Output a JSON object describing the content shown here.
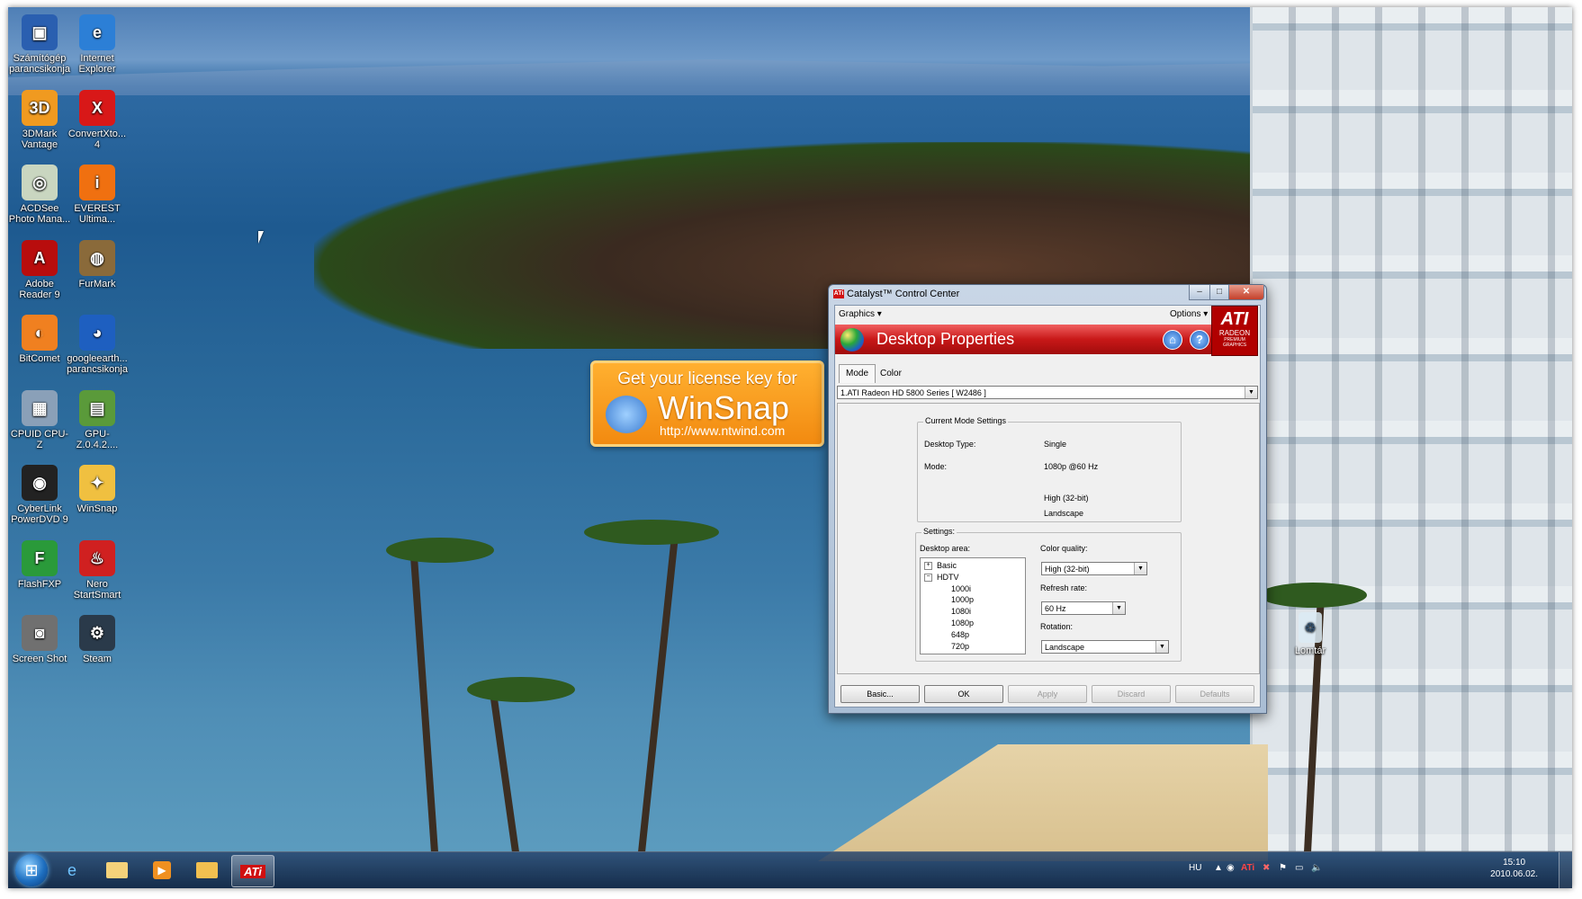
{
  "desktop": {
    "icons": [
      {
        "label": "Számítógép parancsikonja",
        "icon": "computer-icon",
        "color": "#2a5fb0"
      },
      {
        "label": "Internet Explorer",
        "icon": "internet-explorer-icon",
        "color": "#2c7fd6"
      },
      {
        "label": "3DMark Vantage",
        "icon": "3dmark-icon",
        "color": "#f09a20"
      },
      {
        "label": "ConvertXto... 4",
        "icon": "convertx-icon",
        "color": "#d81818"
      },
      {
        "label": "ACDSee Photo Mana...",
        "icon": "acdsee-icon",
        "color": "#c9d6c0"
      },
      {
        "label": "EVEREST Ultima...",
        "icon": "everest-icon",
        "color": "#f07010"
      },
      {
        "label": "Adobe Reader 9",
        "icon": "adobe-reader-icon",
        "color": "#b80d0d"
      },
      {
        "label": "FurMark",
        "icon": "furmark-icon",
        "color": "#8a6a3a"
      },
      {
        "label": "BitComet",
        "icon": "bitcomet-icon",
        "color": "#f08020"
      },
      {
        "label": "googleearth... parancsikonja",
        "icon": "google-earth-icon",
        "color": "#1e5fc0"
      },
      {
        "label": "CPUID CPU-Z",
        "icon": "cpuz-icon",
        "color": "#8aa0b8"
      },
      {
        "label": "GPU-Z.0.4.2....",
        "icon": "gpuz-icon",
        "color": "#5a9a3a"
      },
      {
        "label": "CyberLink PowerDVD 9",
        "icon": "powerdvd-icon",
        "color": "#222222"
      },
      {
        "label": "WinSnap",
        "icon": "winsnap-icon",
        "color": "#f0c040"
      },
      {
        "label": "FlashFXP",
        "icon": "flashfxp-icon",
        "color": "#2a9a3a"
      },
      {
        "label": "Nero StartSmart",
        "icon": "nero-icon",
        "color": "#d02020"
      },
      {
        "label": "Screen Shot",
        "icon": "camera-icon",
        "color": "#707070"
      },
      {
        "label": "Steam",
        "icon": "steam-icon",
        "color": "#2a3a4a"
      }
    ],
    "recycle_bin": {
      "label": "Lomtár",
      "icon": "recycle-bin-icon"
    }
  },
  "promo": {
    "line1": "Get your license key for",
    "line2": "WinSnap",
    "url": "http://www.ntwind.com"
  },
  "window": {
    "title": "Catalyst™ Control Center",
    "menu": {
      "graphics": "Graphics ▾",
      "options": "Options ▾"
    },
    "banner_title": "Desktop Properties",
    "logo": {
      "brand": "ATI",
      "line2": "RADEON",
      "line3": "PREMIUM GRAPHICS"
    },
    "tabs": [
      "Mode",
      "Color"
    ],
    "display_select": "1.ATI Radeon HD 5800 Series [ W2486 ]",
    "current_mode": {
      "legend": "Current Mode Settings",
      "desktop_type_label": "Desktop Type:",
      "desktop_type_value": "Single",
      "mode_label": "Mode:",
      "mode_value": "1080p @60 Hz",
      "color_value": "High (32-bit)",
      "rotation_value": "Landscape"
    },
    "settings": {
      "legend": "Settings:",
      "desktop_area_label": "Desktop area:",
      "tree": [
        {
          "label": "Basic",
          "toggle": "+",
          "level": 0
        },
        {
          "label": "HDTV",
          "toggle": "−",
          "level": 0
        },
        {
          "label": "1000i",
          "toggle": "",
          "level": 1
        },
        {
          "label": "1000p",
          "toggle": "",
          "level": 1
        },
        {
          "label": "1080i",
          "toggle": "",
          "level": 1
        },
        {
          "label": "1080p",
          "toggle": "",
          "level": 1
        },
        {
          "label": "648p",
          "toggle": "",
          "level": 1
        },
        {
          "label": "720p",
          "toggle": "",
          "level": 1
        }
      ],
      "color_quality_label": "Color quality:",
      "color_quality_value": "High (32-bit)",
      "refresh_rate_label": "Refresh rate:",
      "refresh_rate_value": "60 Hz",
      "rotation_label": "Rotation:",
      "rotation_value": "Landscape"
    },
    "buttons": {
      "basic": "Basic...",
      "ok": "OK",
      "apply": "Apply",
      "discard": "Discard",
      "defaults": "Defaults"
    }
  },
  "taskbar": {
    "language": "HU",
    "time": "15:10",
    "date": "2010.06.02.",
    "pinned": [
      {
        "icon": "internet-explorer-icon"
      },
      {
        "icon": "explorer-folder-icon"
      },
      {
        "icon": "media-player-icon"
      },
      {
        "icon": "mail-icon"
      },
      {
        "icon": "ati-catalyst-icon",
        "label": "ATi"
      }
    ]
  }
}
